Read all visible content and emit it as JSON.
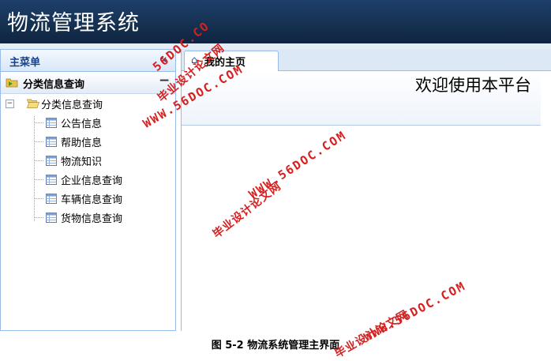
{
  "header": {
    "title": "物流管理系统"
  },
  "sidebar": {
    "title": "主菜单",
    "collapse_glyph": "«",
    "accordion": {
      "label": "分类信息查询",
      "toggle": "−"
    },
    "tree": {
      "root": {
        "label": "分类信息查询",
        "expander": "−"
      },
      "items": [
        {
          "label": "公告信息"
        },
        {
          "label": "帮助信息"
        },
        {
          "label": "物流知识"
        },
        {
          "label": "企业信息查询"
        },
        {
          "label": "车辆信息查询"
        },
        {
          "label": "货物信息查询"
        }
      ]
    }
  },
  "tabs": [
    {
      "label": "我的主页",
      "icon": "home-icon"
    }
  ],
  "main": {
    "welcome": "欢迎使用本平台"
  },
  "caption": "图 5-2 物流系统管理主界面",
  "watermarks": {
    "url": "WWW.56DOC.COM",
    "cn": "毕业设计论文网",
    "url_short": "56DOC.CO"
  },
  "colors": {
    "header_bg": "#15304f",
    "panel_border": "#99bbe8",
    "title_text": "#15428b",
    "watermark": "#d62020"
  }
}
